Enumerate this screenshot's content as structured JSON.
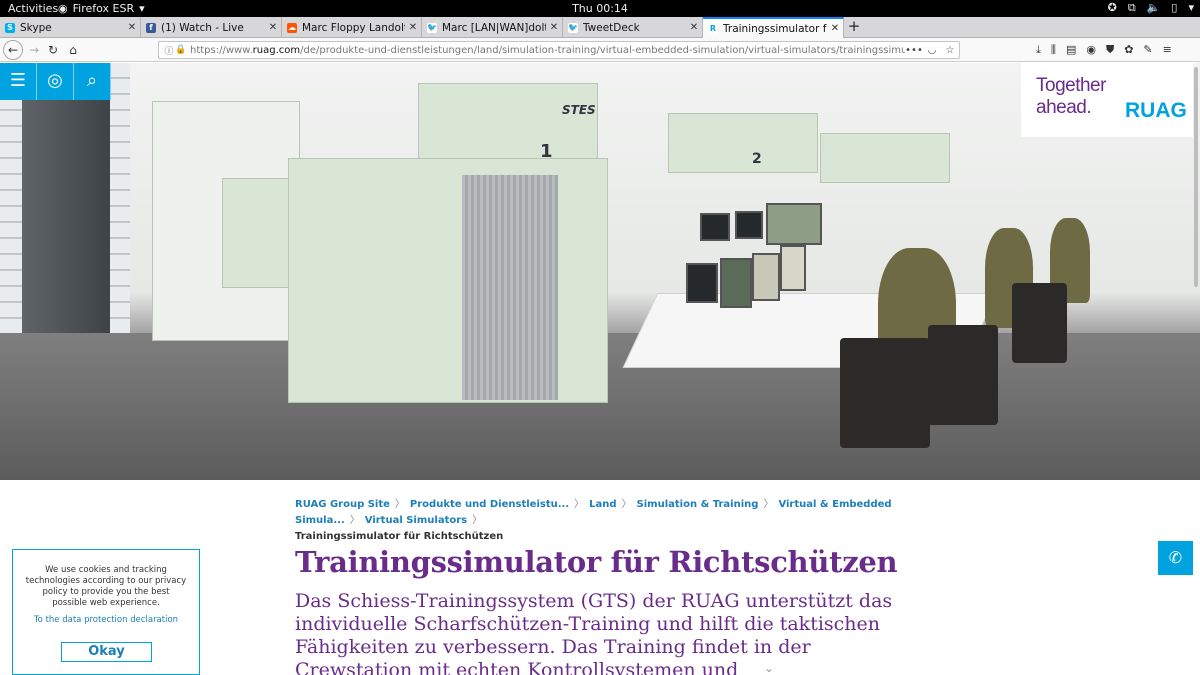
{
  "topbar": {
    "activities": "Activities",
    "app_name": "Firefox ESR",
    "clock": "Thu 00:14"
  },
  "tabs": [
    {
      "title": "Skype",
      "icon": "skype-icon",
      "color": "#00aff0"
    },
    {
      "title": "(1) Watch - Live",
      "icon": "facebook-icon",
      "color": "#3b5998"
    },
    {
      "title": "Marc Floppy Landolt | Fre",
      "icon": "soundcloud-icon",
      "color": "#ff5500"
    },
    {
      "title": "Marc [LAN|WAN]dolt jun",
      "icon": "twitter-icon",
      "color": "#1da1f2"
    },
    {
      "title": "TweetDeck",
      "icon": "twitter-icon",
      "color": "#1da1f2"
    },
    {
      "title": "Trainingssimulator für Ri",
      "icon": "ruag-icon",
      "color": "#00a3e0"
    }
  ],
  "address": {
    "url_prefix": "https://www.",
    "url_domain": "ruag.com",
    "url_path": "/de/produkte-und-dienstleistungen/land/simulation-training/virtual-embedded-simulation/virtual-simulators/trainingssimulator-fuer-richtschuetz"
  },
  "page": {
    "logo": {
      "line1": "Together",
      "line2": "ahead.",
      "brand": "RUAG"
    },
    "breadcrumb": [
      "RUAG Group Site",
      "Produkte und Dienstleistu...",
      "Land",
      "Simulation & Training",
      "Virtual & Embedded Simula...",
      "Virtual Simulators"
    ],
    "breadcrumb_current": "Trainingssimulator für Richtschützen",
    "title": "Trainingssimulator für Richtschützen",
    "lead": "Das Schiess-Trainingssystem (GTS) der RUAG unterstützt das individuelle Scharfschützen-Training und hilft die taktischen Fähigkeiten zu verbessern. Das Training findet in der Crewstation mit echten Kontrollsystemen und",
    "hero_labels": {
      "sim_1": "1",
      "sim_2": "2",
      "sim_brand": "STES"
    }
  },
  "cookie": {
    "text": "We use cookies and tracking technologies according to our privacy policy to provide you the best possible web experience.",
    "link": "To the data protection declaration",
    "button": "Okay"
  },
  "colors": {
    "ruag_blue": "#00a3e0",
    "ruag_purple": "#6a2c8a",
    "link_blue": "#1c7fb8"
  }
}
